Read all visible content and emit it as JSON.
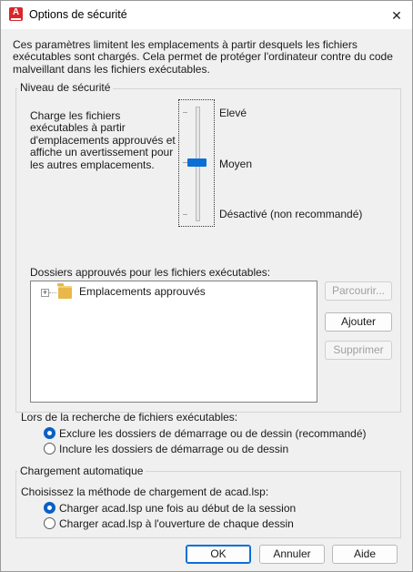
{
  "window": {
    "title": "Options de sécurité",
    "close_glyph": "✕",
    "app_icon_letter": "A",
    "app_icon_color": "#d9262a"
  },
  "intro_text": "Ces paramètres limitent les emplacements à partir desquels les fichiers exécutables sont chargés.  Cela permet de protéger l'ordinateur contre du code malveillant dans les fichiers exécutables.",
  "security_level": {
    "group_label": "Niveau de sécurité",
    "description": "Charge les fichiers exécutables à partir d'emplacements approuvés et affiche un avertissement pour les autres emplacements.",
    "slider_labels": {
      "high": "Elevé",
      "medium": "Moyen",
      "off": "Désactivé (non recommandé)"
    },
    "selected_level": "Moyen"
  },
  "trusted_folders": {
    "label": "Dossiers approuvés pour les fichiers exécutables:",
    "tree_root": "Emplacements approuvés",
    "expander_glyph": "+",
    "browse_button": "Parcourir...",
    "add_button": "Ajouter",
    "remove_button": "Supprimer"
  },
  "search": {
    "label": "Lors de la recherche de fichiers exécutables:",
    "options": [
      {
        "label": "Exclure les dossiers de démarrage ou de dessin (recommandé)",
        "checked": true
      },
      {
        "label": "Inclure les dossiers de démarrage ou de dessin",
        "checked": false
      }
    ]
  },
  "autoload": {
    "group_label": "Chargement automatique",
    "prompt": "Choisissez la méthode de chargement de acad.lsp:",
    "options": [
      {
        "label": "Charger acad.lsp une fois au début de la session",
        "checked": true
      },
      {
        "label": "Charger acad.lsp à l'ouverture de chaque dessin",
        "checked": false
      }
    ]
  },
  "footer": {
    "ok": "OK",
    "cancel": "Annuler",
    "help": "Aide"
  },
  "accent_color": "#0b6fd6"
}
